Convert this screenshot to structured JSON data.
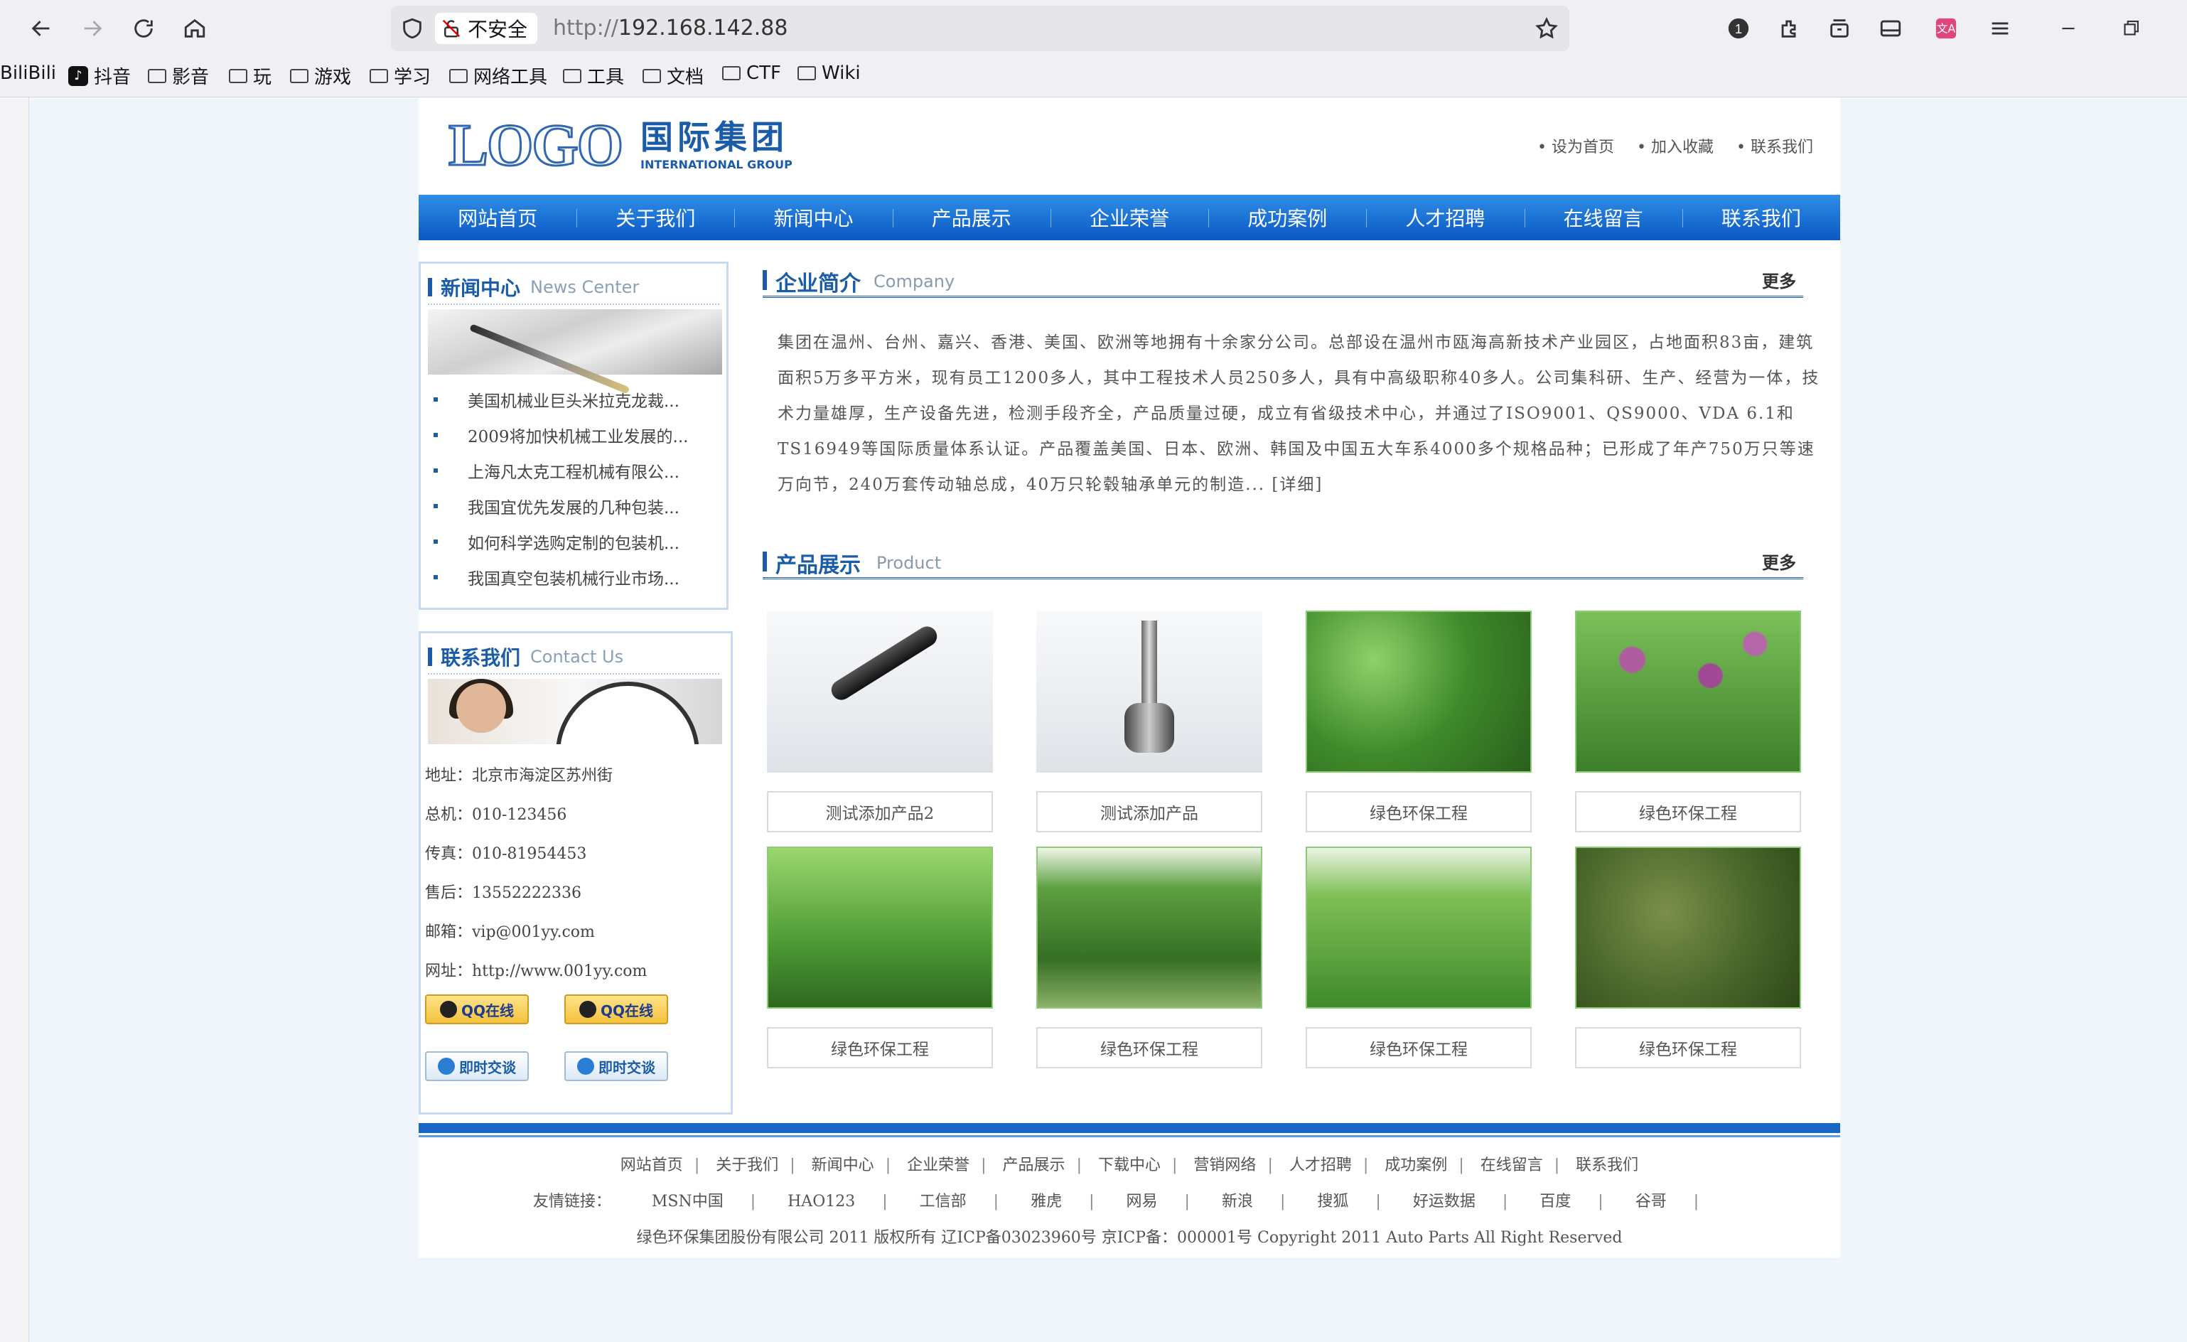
{
  "browser": {
    "security_label": "不安全",
    "url_prefix": "http://",
    "url_host": "192.168.142.88",
    "bookmarks": [
      "BiliBili",
      "抖音",
      "影音",
      "玩",
      "游戏",
      "学习",
      "网络工具",
      "工具",
      "文档",
      "CTF",
      "Wiki"
    ]
  },
  "site": {
    "logo_text": "LOGO",
    "logo_cn": "国际集团",
    "logo_en": "INTERNATIONAL GROUP",
    "top_links": [
      "设为首页",
      "加入收藏",
      "联系我们"
    ],
    "nav": [
      "网站首页",
      "关于我们",
      "新闻中心",
      "产品展示",
      "企业荣誉",
      "成功案例",
      "人才招聘",
      "在线留言",
      "联系我们"
    ],
    "news": {
      "title_cn": "新闻中心",
      "title_en": "News Center",
      "items": [
        "美国机械业巨头米拉克龙裁...",
        "2009将加快机械工业发展的...",
        "上海凡太克工程机械有限公...",
        "我国宜优先发展的几种包装...",
        "如何科学选购定制的包装机...",
        "我国真空包装机械行业市场..."
      ]
    },
    "contact": {
      "title_cn": "联系我们",
      "title_en": "Contact Us",
      "lines": [
        "地址：北京市海淀区苏州街",
        "总机：010-123456",
        "传真：010-81954453",
        "售后：13552222336",
        "邮箱：vip@001yy.com",
        "网址：http://www.001yy.com"
      ],
      "qq_label": "QQ在线",
      "chat_label": "即时交谈"
    },
    "company": {
      "title_cn": "企业简介",
      "title_en": "Company",
      "more": "更多",
      "text": "集团在温州、台州、嘉兴、香港、美国、欧洲等地拥有十余家分公司。总部设在温州市瓯海高新技术产业园区，占地面积83亩，建筑面积5万多平方米，现有员工1200多人，其中工程技术人员250多人，具有中高级职称40多人。公司集科研、生产、经营为一体，技术力量雄厚，生产设备先进，检测手段齐全，产品质量过硬，成立有省级技术中心，并通过了ISO9001、QS9000、VDA 6.1和TS16949等国际质量体系认证。产品覆盖美国、日本、欧洲、韩国及中国五大车系4000多个规格品种；已形成了年产750万只等速万向节，240万套传动轴总成，40万只轮毂轴承单元的制造... [详细]"
    },
    "products": {
      "title_cn": "产品展示",
      "title_en": "Product",
      "more": "更多",
      "items": [
        "测试添加产品2",
        "测试添加产品",
        "绿色环保工程",
        "绿色环保工程",
        "绿色环保工程",
        "绿色环保工程",
        "绿色环保工程",
        "绿色环保工程"
      ]
    },
    "footer": {
      "links": [
        "网站首页",
        "关于我们",
        "新闻中心",
        "企业荣誉",
        "产品展示",
        "下载中心",
        "营销网络",
        "人才招聘",
        "成功案例",
        "在线留言",
        "联系我们"
      ],
      "friends_label": "友情链接：",
      "friends": [
        "MSN中国",
        "HAO123",
        "工信部",
        "雅虎",
        "网易",
        "新浪",
        "搜狐",
        "好运数据",
        "百度",
        "谷哥"
      ],
      "copyright": "绿色环保集团股份有限公司 2011 版权所有 辽ICP备03023960号 京ICP备：000001号 Copyright 2011 Auto Parts All Right Reserved"
    }
  }
}
